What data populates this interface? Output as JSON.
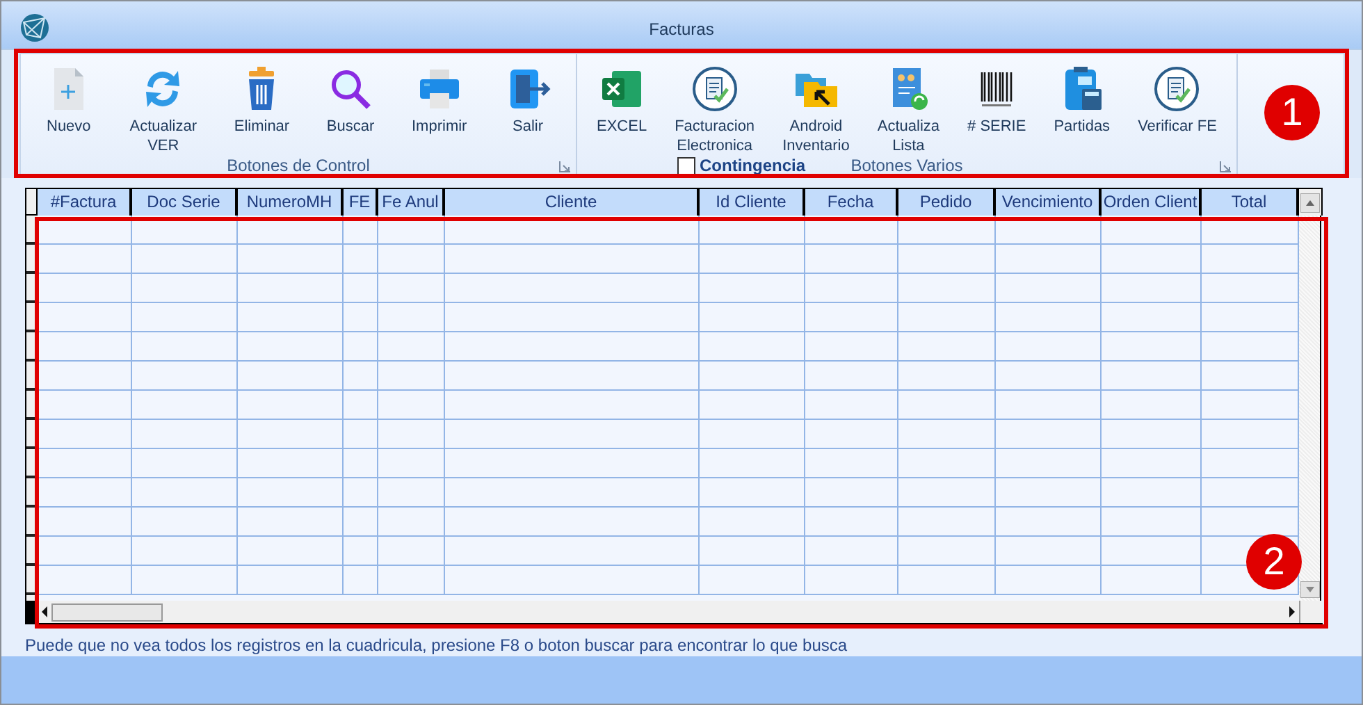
{
  "window": {
    "title": "Facturas"
  },
  "ribbon": {
    "groups": [
      {
        "label": "Botones de Control",
        "buttons": [
          {
            "kind": "new",
            "lines": [
              "Nuevo"
            ]
          },
          {
            "kind": "refresh",
            "lines": [
              "Actualizar",
              "VER"
            ]
          },
          {
            "kind": "trash",
            "lines": [
              "Eliminar"
            ]
          },
          {
            "kind": "search",
            "lines": [
              "Buscar"
            ]
          },
          {
            "kind": "print",
            "lines": [
              "Imprimir"
            ]
          },
          {
            "kind": "exit",
            "lines": [
              "Salir"
            ]
          }
        ]
      },
      {
        "label": "Botones Varios",
        "checkbox": {
          "label": "Contingencia",
          "checked": false
        },
        "buttons": [
          {
            "kind": "excel",
            "lines": [
              "EXCEL"
            ]
          },
          {
            "kind": "seal",
            "lines": [
              "Facturacion",
              "Electronica"
            ]
          },
          {
            "kind": "folder",
            "lines": [
              "Android",
              "Inventario"
            ]
          },
          {
            "kind": "list",
            "lines": [
              "Actualiza",
              "Lista"
            ]
          },
          {
            "kind": "barcode",
            "lines": [
              "# SERIE"
            ]
          },
          {
            "kind": "calc",
            "lines": [
              "Partidas"
            ]
          },
          {
            "kind": "seal",
            "lines": [
              "Verificar FE"
            ]
          }
        ]
      }
    ]
  },
  "table": {
    "columns": [
      "#Factura",
      "Doc Serie",
      "NumeroMH",
      "FE",
      "Fe Anul",
      "Cliente",
      "Id Cliente",
      "Fecha",
      "Pedido",
      "Vencimiento",
      "Orden Client",
      "Total"
    ]
  },
  "hint": "Puede que no vea todos los registros en la cuadricula, presione F8 o boton buscar para encontrar lo que busca",
  "callouts": [
    {
      "label": "1"
    },
    {
      "label": "2"
    }
  ]
}
